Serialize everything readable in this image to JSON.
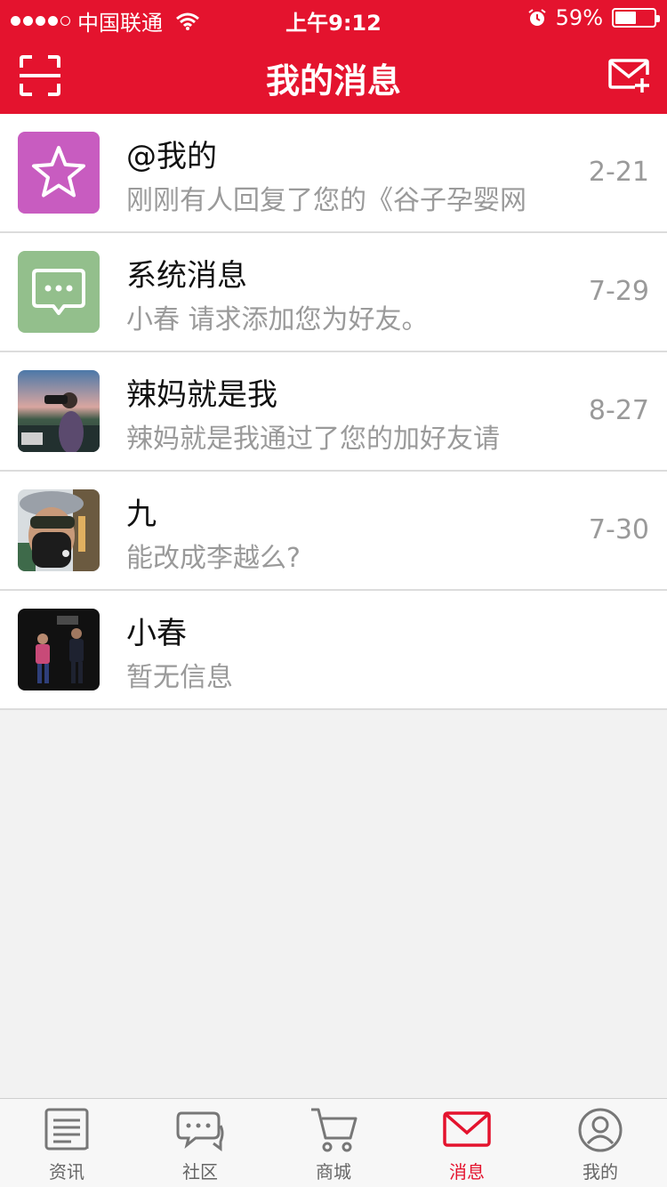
{
  "status_bar": {
    "carrier": "中国联通",
    "time": "上午9:12",
    "battery": "59%",
    "battery_level": 0.59,
    "signal_bars": 4
  },
  "nav": {
    "title": "我的消息",
    "left_icon": "scan-icon",
    "right_icon": "compose-mail-icon"
  },
  "messages": [
    {
      "title": "@我的",
      "subtitle": "刚刚有人回复了您的《谷子孕婴网",
      "date": "2-21",
      "avatar": "star-icon",
      "avatar_color": "#c85cc0"
    },
    {
      "title": "系统消息",
      "subtitle": "小春 请求添加您为好友。",
      "date": "7-29",
      "avatar": "chat-bubble-icon",
      "avatar_color": "#93bf8c"
    },
    {
      "title": "辣妈就是我",
      "subtitle": "辣妈就是我通过了您的加好友请",
      "date": "8-27",
      "avatar": "photo-photographer"
    },
    {
      "title": "九",
      "subtitle": "能改成李越么?",
      "date": "7-30",
      "avatar": "photo-masked-person"
    },
    {
      "title": "小春",
      "subtitle": "暂无信息",
      "date": "",
      "avatar": "photo-stage"
    }
  ],
  "tabs": [
    {
      "label": "资讯",
      "icon": "news-icon"
    },
    {
      "label": "社区",
      "icon": "community-icon"
    },
    {
      "label": "商城",
      "icon": "cart-icon"
    },
    {
      "label": "消息",
      "icon": "mail-icon",
      "active": true
    },
    {
      "label": "我的",
      "icon": "profile-icon"
    }
  ],
  "colors": {
    "brand_red": "#e4132e",
    "text_gray": "#9a9a9a",
    "background": "#f2f2f2"
  }
}
